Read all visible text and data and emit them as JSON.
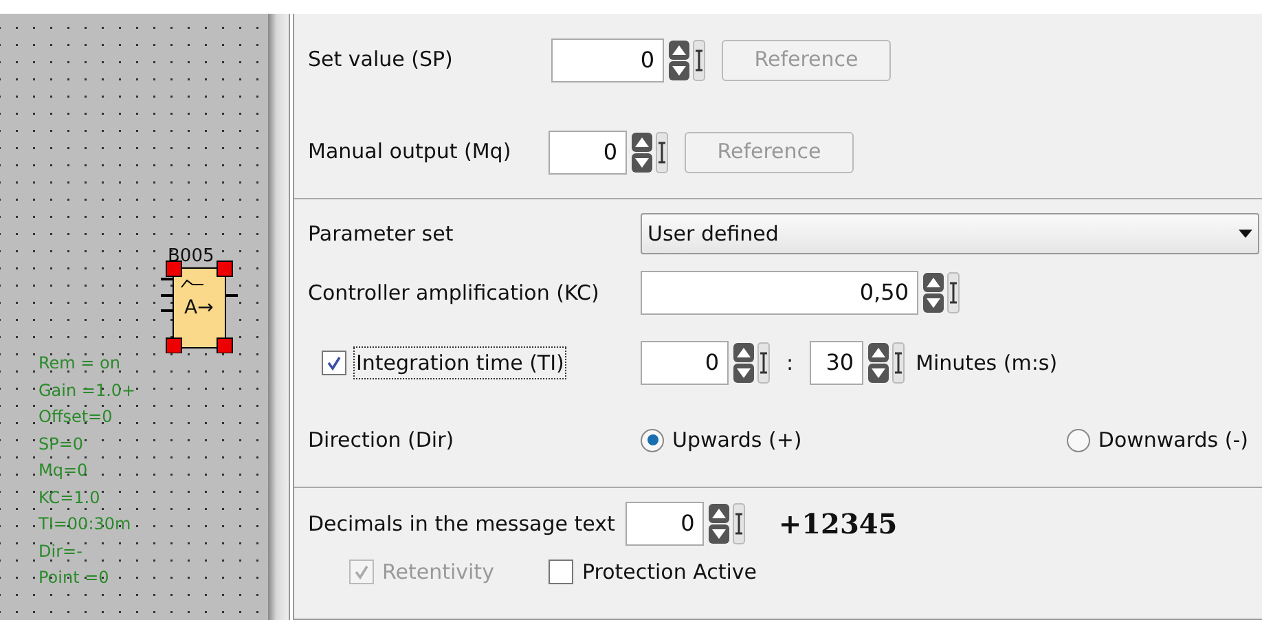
{
  "canvas": {
    "block": {
      "name": "B005",
      "symbol": "A→"
    },
    "annotations": [
      "Rem = on",
      "Gain =1.0+",
      "Offset=0",
      "SP=0",
      "Mq=0",
      "KC=1.0",
      "TI=00:30m",
      "Dir=-",
      "Point =0"
    ]
  },
  "set_value": {
    "label": "Set value (SP)",
    "value": "0",
    "reference": {
      "label": "Reference",
      "disabled": true
    }
  },
  "manual_output": {
    "label": "Manual output (Mq)",
    "value": "0",
    "reference": {
      "label": "Reference",
      "disabled": true
    }
  },
  "parameter_set": {
    "label": "Parameter set",
    "value": "User defined"
  },
  "controller_amplification": {
    "label": "Controller amplification (KC)",
    "value": "0,50"
  },
  "integration_time": {
    "label": "Integration time (TI)",
    "checked": true,
    "minutes": "0",
    "separator": ":",
    "seconds": "30",
    "unit": "Minutes (m:s)"
  },
  "direction": {
    "label": "Direction (Dir)",
    "options": [
      {
        "label": "Upwards (+)",
        "selected": true
      },
      {
        "label": "Downwards (-)",
        "selected": false
      }
    ]
  },
  "decimals": {
    "label": "Decimals in the message text",
    "value": "0",
    "preview": "+12345"
  },
  "options": [
    {
      "label": "Retentivity",
      "checked": true,
      "disabled": true
    },
    {
      "label": "Protection Active",
      "checked": false,
      "disabled": false
    }
  ]
}
